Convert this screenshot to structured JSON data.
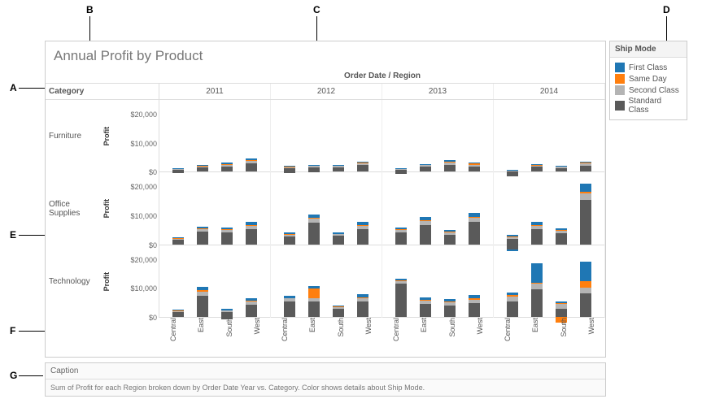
{
  "title": "Annual Profit by Product",
  "columns_header": "Order Date / Region",
  "row_header": "Category",
  "years": [
    "2011",
    "2012",
    "2013",
    "2014"
  ],
  "regions": [
    "Central",
    "East",
    "South",
    "West"
  ],
  "categories": [
    "Furniture",
    "Office Supplies",
    "Technology"
  ],
  "axis_label": "Profit",
  "y_ticks": [
    "$0",
    "$10,000",
    "$20,000"
  ],
  "y_max": 25000,
  "legend": {
    "title": "Ship Mode",
    "items": [
      {
        "name": "First Class",
        "color": "#1f77b4"
      },
      {
        "name": "Same Day",
        "color": "#ff7f0e"
      },
      {
        "name": "Second Class",
        "color": "#b4b4b4"
      },
      {
        "name": "Standard Class",
        "color": "#5a5a5a"
      }
    ]
  },
  "caption": {
    "title": "Caption",
    "text": "Sum of Profit for each Region broken down by Order Date Year vs. Category.  Color shows details about Ship Mode."
  },
  "callouts": {
    "A": "A",
    "B": "B",
    "C": "C",
    "D": "D",
    "E": "E",
    "F": "F",
    "G": "G"
  },
  "chart_data": {
    "type": "bar",
    "note": "Stacked bar small-multiples; rows=categories, cols=years, x=regions, stacks=ship-mode; values approx USD profit read from chart.",
    "series_order": [
      "Standard Class",
      "Second Class",
      "Same Day",
      "First Class"
    ],
    "data": {
      "Furniture": {
        "2011": {
          "Central": {
            "Standard Class": 600,
            "Second Class": 300,
            "Same Day": 100,
            "First Class": 200,
            "neg": {
              "Standard Class": -400
            }
          },
          "East": {
            "Standard Class": 1500,
            "Second Class": 500,
            "Same Day": 100,
            "First Class": 300
          },
          "South": {
            "Standard Class": 1800,
            "Second Class": 800,
            "Same Day": 200,
            "First Class": 500
          },
          "West": {
            "Standard Class": 3000,
            "Second Class": 900,
            "Same Day": 200,
            "First Class": 600
          }
        },
        "2012": {
          "Central": {
            "Standard Class": 1300,
            "Second Class": 400,
            "Same Day": 100,
            "First Class": 300,
            "neg": {
              "Standard Class": -500
            }
          },
          "East": {
            "Standard Class": 1700,
            "Second Class": 400,
            "Same Day": 100,
            "First Class": 300,
            "neg": {
              "Standard Class": -300
            }
          },
          "South": {
            "Standard Class": 1600,
            "Second Class": 500,
            "Same Day": 100,
            "First Class": 300
          },
          "West": {
            "Standard Class": 2400,
            "Second Class": 700,
            "Same Day": 200,
            "First Class": 400
          }
        },
        "2013": {
          "Central": {
            "Standard Class": 700,
            "Second Class": 300,
            "Same Day": 100,
            "First Class": 200,
            "neg": {
              "Standard Class": -800
            }
          },
          "East": {
            "Standard Class": 1800,
            "Second Class": 600,
            "Same Day": 100,
            "First Class": 400
          },
          "South": {
            "Standard Class": 2600,
            "Second Class": 800,
            "Same Day": 200,
            "First Class": 500
          },
          "West": {
            "Standard Class": 2000,
            "Second Class": 600,
            "Same Day": 300,
            "First Class": 400
          }
        },
        "2014": {
          "Central": {
            "Standard Class": 0,
            "Second Class": 300,
            "Same Day": 100,
            "First Class": 200,
            "neg": {
              "Standard Class": -1800
            }
          },
          "East": {
            "Standard Class": 1800,
            "Second Class": 500,
            "Same Day": 100,
            "First Class": 400
          },
          "South": {
            "Standard Class": 1400,
            "Second Class": 400,
            "Same Day": 100,
            "First Class": 300
          },
          "West": {
            "Standard Class": 2200,
            "Second Class": 700,
            "Same Day": 300,
            "First Class": 500
          }
        }
      },
      "Office Supplies": {
        "2011": {
          "Central": {
            "Standard Class": 1600,
            "Second Class": 500,
            "Same Day": 200,
            "First Class": 400
          },
          "East": {
            "Standard Class": 4500,
            "Second Class": 900,
            "Same Day": 300,
            "First Class": 800
          },
          "South": {
            "Standard Class": 4200,
            "Second Class": 900,
            "Same Day": 300,
            "First Class": 700
          },
          "West": {
            "Standard Class": 5500,
            "Second Class": 1100,
            "Same Day": 400,
            "First Class": 1000
          }
        },
        "2012": {
          "Central": {
            "Standard Class": 2800,
            "Second Class": 700,
            "Same Day": 200,
            "First Class": 500
          },
          "East": {
            "Standard Class": 7800,
            "Second Class": 1400,
            "Same Day": 400,
            "First Class": 1300
          },
          "South": {
            "Standard Class": 3000,
            "Second Class": 600,
            "Same Day": 200,
            "First Class": 500
          },
          "West": {
            "Standard Class": 5500,
            "Second Class": 1100,
            "Same Day": 400,
            "First Class": 1000
          }
        },
        "2013": {
          "Central": {
            "Standard Class": 4200,
            "Second Class": 900,
            "Same Day": 300,
            "First Class": 800
          },
          "East": {
            "Standard Class": 7000,
            "Second Class": 1300,
            "Same Day": 400,
            "First Class": 1200
          },
          "South": {
            "Standard Class": 3500,
            "Second Class": 800,
            "Same Day": 300,
            "First Class": 700
          },
          "West": {
            "Standard Class": 8000,
            "Second Class": 1500,
            "Same Day": 500,
            "First Class": 1400
          }
        },
        "2014": {
          "Central": {
            "Standard Class": 2000,
            "Second Class": 600,
            "Same Day": 200,
            "First Class": 500,
            "neg": {
              "Standard Class": -2000,
              "First Class": -500
            }
          },
          "East": {
            "Standard Class": 5500,
            "Second Class": 1100,
            "Same Day": 400,
            "First Class": 1000
          },
          "South": {
            "Standard Class": 4000,
            "Second Class": 900,
            "Same Day": 300,
            "First Class": 700
          },
          "West": {
            "Standard Class": 16000,
            "Second Class": 2500,
            "Same Day": 600,
            "First Class": 3000
          }
        }
      },
      "Technology": {
        "2011": {
          "Central": {
            "Standard Class": 1800,
            "Second Class": 400,
            "Same Day": 100,
            "First Class": 300
          },
          "East": {
            "Standard Class": 7500,
            "Second Class": 1500,
            "Same Day": 600,
            "First Class": 1400
          },
          "South": {
            "Standard Class": 1800,
            "Second Class": 500,
            "Same Day": 200,
            "First Class": 400,
            "neg": {
              "Standard Class": -800
            }
          },
          "West": {
            "Standard Class": 4500,
            "Second Class": 1000,
            "Same Day": 400,
            "First Class": 800
          }
        },
        "2012": {
          "Central": {
            "Standard Class": 5500,
            "Second Class": 1200,
            "Same Day": 200,
            "First Class": 800
          },
          "East": {
            "Standard Class": 5500,
            "Second Class": 1200,
            "Same Day": 3500,
            "First Class": 1000
          },
          "South": {
            "Standard Class": 2800,
            "Second Class": 700,
            "Same Day": 200,
            "First Class": 500
          },
          "West": {
            "Standard Class": 5500,
            "Second Class": 1200,
            "Same Day": 400,
            "First Class": 1000
          }
        },
        "2013": {
          "Central": {
            "Standard Class": 12000,
            "Second Class": 1000,
            "Same Day": 300,
            "First Class": 500
          },
          "East": {
            "Standard Class": 4800,
            "Second Class": 1000,
            "Same Day": 400,
            "First Class": 900
          },
          "South": {
            "Standard Class": 4200,
            "Second Class": 1000,
            "Same Day": 400,
            "First Class": 900
          },
          "West": {
            "Standard Class": 5000,
            "Second Class": 1200,
            "Same Day": 700,
            "First Class": 1000
          }
        },
        "2014": {
          "Central": {
            "Standard Class": 5500,
            "Second Class": 1900,
            "Same Day": 400,
            "First Class": 1000
          },
          "East": {
            "Standard Class": 10000,
            "Second Class": 2000,
            "Same Day": 500,
            "First Class": 7000
          },
          "South": {
            "Standard Class": 2800,
            "Second Class": 2000,
            "Same Day": 300,
            "First Class": 500,
            "neg": {
              "Same Day": -2000
            }
          },
          "West": {
            "Standard Class": 8500,
            "Second Class": 2000,
            "Same Day": 2500,
            "First Class": 7000
          }
        }
      }
    }
  }
}
